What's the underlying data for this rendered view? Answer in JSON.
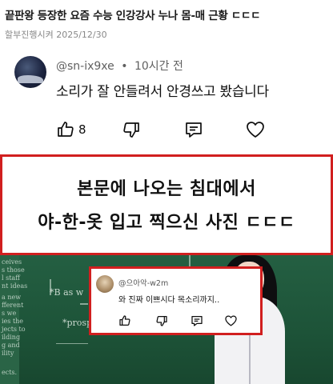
{
  "header": {
    "title": "끝판왕 등장한 요즘 수능 인강강사 누나 몸-매 근황 ㄷㄷㄷ",
    "meta": "할부진행시켜 2025/12/30"
  },
  "comment_top": {
    "handle": "@sn-ix9xe",
    "separator": "•",
    "time": "10시간 전",
    "text": "소리가 잘 안들려서 안경쓰고 봤습니다",
    "like_count": "8",
    "icons": [
      "thumbs-up-icon",
      "thumbs-down-icon",
      "reply-icon",
      "heart-icon"
    ]
  },
  "banner": {
    "line1": "본문에 나오는 침대에서",
    "line2": "야-한-옷 입고 찍으신 사진 ㄷㄷㄷ"
  },
  "photo_comment": {
    "handle": "@으아악-w2m",
    "text": "와 진짜 이쁘시다 목소리까지..",
    "icons": [
      "thumbs-up-icon",
      "thumbs-down-icon",
      "reply-icon",
      "heart-icon"
    ]
  },
  "colors": {
    "highlight_border": "#d11f1f",
    "chalkboard": "#1f5a3c",
    "meta_gray": "#888888"
  }
}
